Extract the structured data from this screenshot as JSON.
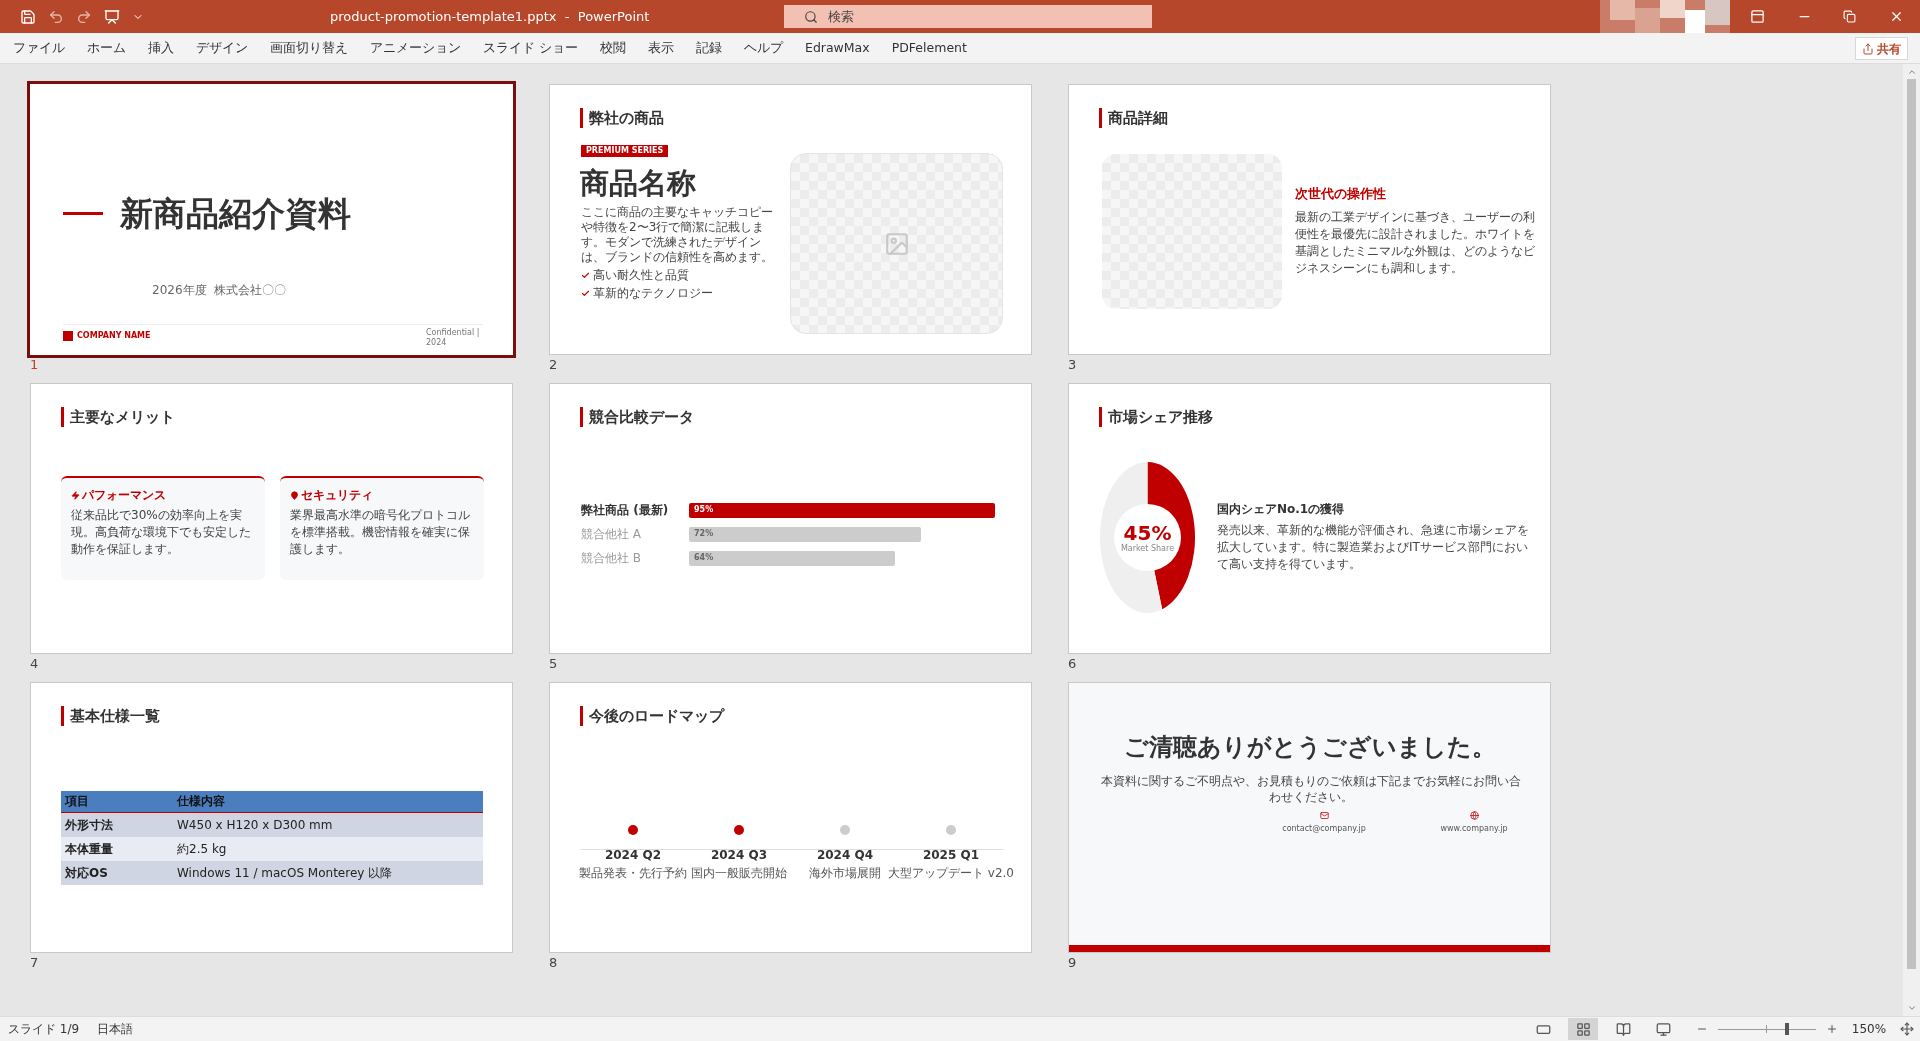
{
  "title_bar": {
    "title": "product-promotion-template1.pptx  -  PowerPoint",
    "search_placeholder": "検索"
  },
  "menu": [
    "ファイル",
    "ホーム",
    "挿入",
    "デザイン",
    "画面切り替え",
    "アニメーション",
    "スライド ショー",
    "校閲",
    "表示",
    "記録",
    "ヘルプ",
    "EdrawMax",
    "PDFelement"
  ],
  "share_button": "共有",
  "slides": [
    {
      "kind": "title",
      "number": "1",
      "selected": true,
      "title": "新商品紹介資料",
      "subtitle": "2026年度  株式会社〇〇",
      "company": "COMPANY NAME",
      "confidential": "Confidential |",
      "year": "2024"
    },
    {
      "kind": "product",
      "number": "2",
      "selected": false,
      "heading": "弊社の商品",
      "badge": "PREMIUM SERIES",
      "name": "商品名称",
      "description": "ここに商品の主要なキャッチコピーや特徴を2〜3行で簡潔に記載します。モダンで洗練されたデザインは、ブランドの信頼性を高めます。",
      "features": [
        "高い耐久性と品質",
        "革新的なテクノロジー"
      ]
    },
    {
      "kind": "detail",
      "number": "3",
      "selected": false,
      "heading": "商品詳細",
      "subheading": "次世代の操作性",
      "body": "最新の工業デザインに基づき、ユーザーの利便性を最優先に設計されました。ホワイトを基調としたミニマルな外観は、どのようなビジネスシーンにも調和します。"
    },
    {
      "kind": "merits",
      "number": "4",
      "selected": false,
      "heading": "主要なメリット",
      "cards": [
        {
          "kind": "performance",
          "title": "パフォーマンス",
          "body": "従来品比で30%の効率向上を実現。高負荷な環境下でも安定した動作を保証します。"
        },
        {
          "kind": "security",
          "title": "セキュリティ",
          "body": "業界最高水準の暗号化プロトコルを標準搭載。機密情報を確実に保護します。"
        }
      ]
    },
    {
      "kind": "bars",
      "number": "5",
      "selected": false,
      "heading": "競合比較データ",
      "chart_data": {
        "type": "bar",
        "orientation": "horizontal",
        "categories": [
          "弊社商品 (最新)",
          "競合他社 A",
          "競合他社 B"
        ],
        "values": [
          95,
          72,
          64
        ],
        "value_labels": [
          "95%",
          "72%",
          "64%"
        ]
      }
    },
    {
      "kind": "share",
      "number": "6",
      "selected": false,
      "heading": "市場シェア推移",
      "chart_data": {
        "type": "donut",
        "values": [
          45,
          55
        ]
      },
      "share_value": "45%",
      "share_caption": "Market Share",
      "side_title": "国内シェアNo.1の獲得",
      "body": "発売以来、革新的な機能が評価され、急速に市場シェアを拡大しています。特に製造業およびITサービス部門において高い支持を得ています。"
    },
    {
      "kind": "table",
      "number": "7",
      "selected": false,
      "heading": "基本仕様一覧",
      "columns": [
        "項目",
        "仕様内容"
      ],
      "rows": [
        [
          "外形寸法",
          "W450 x H120 x D300 mm"
        ],
        [
          "本体重量",
          "約2.5 kg"
        ],
        [
          "対応OS",
          "Windows 11 / macOS Monterey 以降"
        ]
      ]
    },
    {
      "kind": "roadmap",
      "number": "8",
      "selected": false,
      "heading": "今後のロードマップ",
      "milestones": [
        {
          "label": "2024 Q2",
          "text": "製品発表・先行予約",
          "done": true
        },
        {
          "label": "2024 Q3",
          "text": "国内一般販売開始",
          "done": true
        },
        {
          "label": "2024 Q4",
          "text": "海外市場展開",
          "done": false
        },
        {
          "label": "2025 Q1",
          "text": "大型アップデート v2.0",
          "done": false
        }
      ]
    },
    {
      "kind": "closing",
      "number": "9",
      "selected": false,
      "title": "ご清聴ありがとうございました。",
      "body": "本資料に関するご不明点や、お見積もりのご依頼は下記までお気軽にお問い合わせください。",
      "contacts": [
        {
          "kind": "mail",
          "text": "contact@company.jp"
        },
        {
          "kind": "web",
          "text": "www.company.jp"
        }
      ]
    }
  ],
  "status_bar": {
    "slide_indicator": "スライド 1/9",
    "language": "日本語",
    "views": [
      {
        "kind": "normal",
        "selected": false
      },
      {
        "kind": "sorter",
        "selected": true
      },
      {
        "kind": "reading",
        "selected": false
      },
      {
        "kind": "show",
        "selected": false
      }
    ],
    "zoom": {
      "level": 0.7,
      "reading": "150%"
    }
  }
}
